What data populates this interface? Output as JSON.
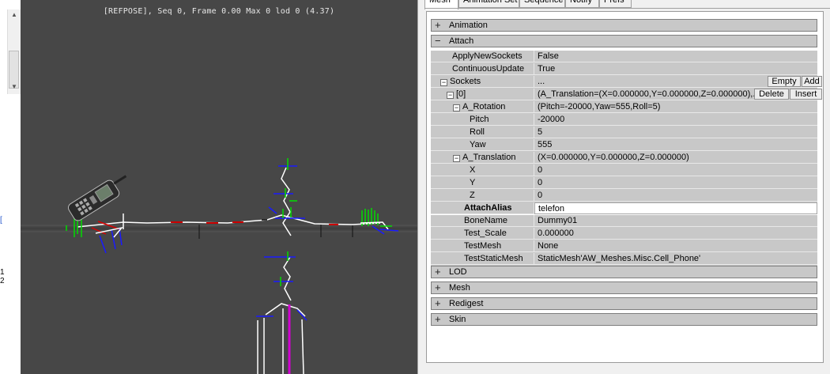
{
  "viewport": {
    "info": "[REFPOSE], Seq 0,  Frame  0.00 Max 0  lod 0 (4.37)"
  },
  "left_strip": {
    "marks": [
      "[",
      "1",
      "2"
    ]
  },
  "tabs": [
    {
      "label": "Mesh",
      "active": true
    },
    {
      "label": "Animation Set",
      "active": false
    },
    {
      "label": "Sequence",
      "active": false
    },
    {
      "label": "Notify",
      "active": false
    },
    {
      "label": "Prefs",
      "active": false
    }
  ],
  "property_grid": {
    "categories": {
      "animation": {
        "label": "Animation",
        "expander": "+"
      },
      "attach": {
        "label": "Attach",
        "expander": "−"
      },
      "lod": {
        "label": "LOD",
        "expander": "+"
      },
      "mesh": {
        "label": "Mesh",
        "expander": "+"
      },
      "redigest": {
        "label": "Redigest",
        "expander": "+"
      },
      "skin": {
        "label": "Skin",
        "expander": "+"
      }
    },
    "rows": [
      {
        "name": "ApplyNewSockets",
        "value": "False"
      },
      {
        "name": "ContinuousUpdate",
        "value": "True"
      },
      {
        "name": "Sockets",
        "value": "...",
        "toggle": "−"
      },
      {
        "name": "[0]",
        "value": "(A_Translation=(X=0.000000,Y=0.000000,Z=0.000000),...",
        "toggle": "−"
      },
      {
        "name": "A_Rotation",
        "value": "(Pitch=-20000,Yaw=555,Roll=5)",
        "toggle": "−"
      },
      {
        "name": "Pitch",
        "value": "-20000"
      },
      {
        "name": "Roll",
        "value": "5"
      },
      {
        "name": "Yaw",
        "value": "555"
      },
      {
        "name": "A_Translation",
        "value": "(X=0.000000,Y=0.000000,Z=0.000000)",
        "toggle": "−"
      },
      {
        "name": "X",
        "value": "0"
      },
      {
        "name": "Y",
        "value": "0"
      },
      {
        "name": "Z",
        "value": "0"
      },
      {
        "name": "AttachAlias",
        "value": "telefon",
        "selected": true
      },
      {
        "name": "BoneName",
        "value": "Dummy01"
      },
      {
        "name": "Test_Scale",
        "value": "0.000000"
      },
      {
        "name": "TestMesh",
        "value": "None"
      },
      {
        "name": "TestStaticMesh",
        "value": "StaticMesh'AW_Meshes.Misc.Cell_Phone'"
      }
    ],
    "buttons": {
      "empty": "Empty",
      "add": "Add",
      "delete": "Delete",
      "insert": "Insert"
    }
  },
  "colors": {
    "viewport_bg": "#474747",
    "category_bg": "#c8c8c8",
    "bone_white": "#ffffff",
    "axis_green": "#00e000",
    "axis_blue": "#1a1aff",
    "axis_red": "#e00000",
    "root_magenta": "#d000d0"
  }
}
